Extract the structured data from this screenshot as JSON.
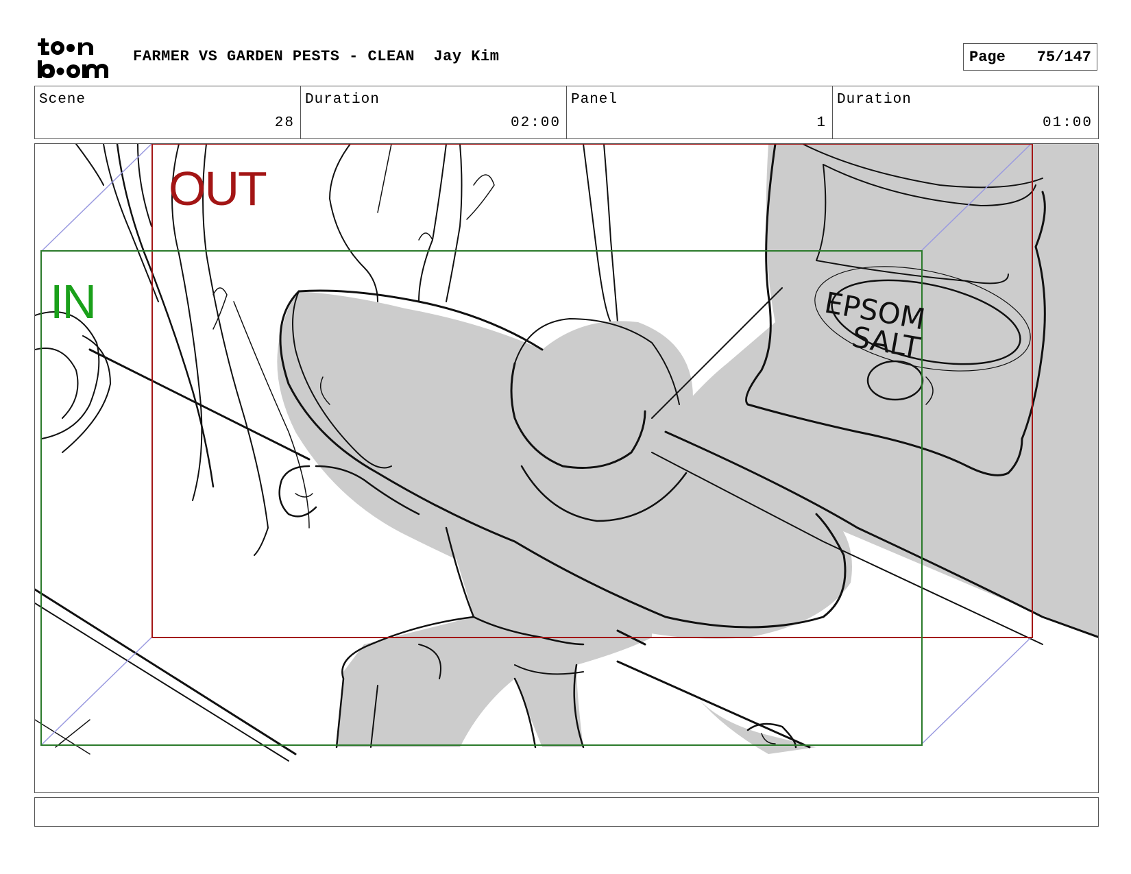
{
  "header": {
    "logo_text": "toonboom",
    "project_title": "FARMER VS GARDEN PESTS - CLEAN",
    "artist": "Jay Kim",
    "page_label": "Page",
    "page_number": "75/147"
  },
  "info": {
    "scene_label": "Scene",
    "scene_value": "28",
    "scene_duration_label": "Duration",
    "scene_duration_value": "02:00",
    "panel_label": "Panel",
    "panel_value": "1",
    "panel_duration_label": "Duration",
    "panel_duration_value": "01:00"
  },
  "panel": {
    "camera_out_label": "OUT",
    "camera_in_label": "IN",
    "sign_text_line1": "EPSOM",
    "sign_text_line2": "SALT",
    "colors": {
      "camera_out": "#a31515",
      "camera_in": "#1aa01a",
      "camera_path": "#9a9ae0",
      "fill_gray": "#cccccc",
      "ink": "#111111"
    }
  },
  "notes": {
    "text": ""
  }
}
